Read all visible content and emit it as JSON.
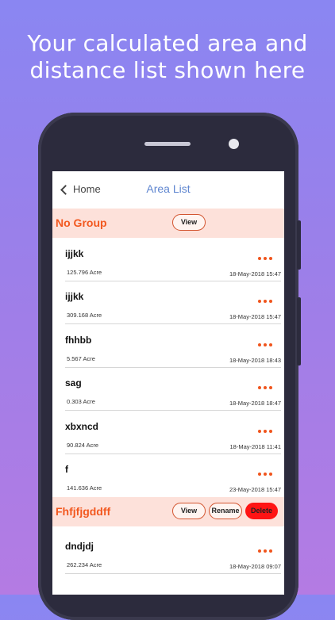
{
  "headline": {
    "line1": "Your calculated area and",
    "line2": "distance list shown here"
  },
  "nav": {
    "back_label": "Home",
    "title": "Area List"
  },
  "groups": [
    {
      "name": "No Group",
      "buttons": {
        "view": "View"
      },
      "items": [
        {
          "name": "ijjkk",
          "area": "125.796 Acre",
          "date": "18-May-2018 15:47"
        },
        {
          "name": "ijjkk",
          "area": "309.168 Acre",
          "date": "18-May-2018 15:47"
        },
        {
          "name": "fhhbb",
          "area": "5.567 Acre",
          "date": "18-May-2018 18:43"
        },
        {
          "name": "sag",
          "area": "0.303 Acre",
          "date": "18-May-2018 18:47"
        },
        {
          "name": "xbxncd",
          "area": "90.824 Acre",
          "date": "18-May-2018 11:41"
        },
        {
          "name": "f",
          "area": "141.636 Acre",
          "date": "23-May-2018 15:47"
        }
      ]
    },
    {
      "name": "Fhfjfjgddff",
      "buttons": {
        "view": "View",
        "rename": "Rename",
        "delete": "Delete"
      },
      "items": [
        {
          "name": "dndjdj",
          "area": "262.234 Acre",
          "date": "18-May-2018 09:07"
        }
      ]
    }
  ],
  "colors": {
    "accent_orange": "#f2581f",
    "group_bar": "#fde1da",
    "nav_title": "#5f86d0",
    "delete_red": "#ff1414"
  }
}
